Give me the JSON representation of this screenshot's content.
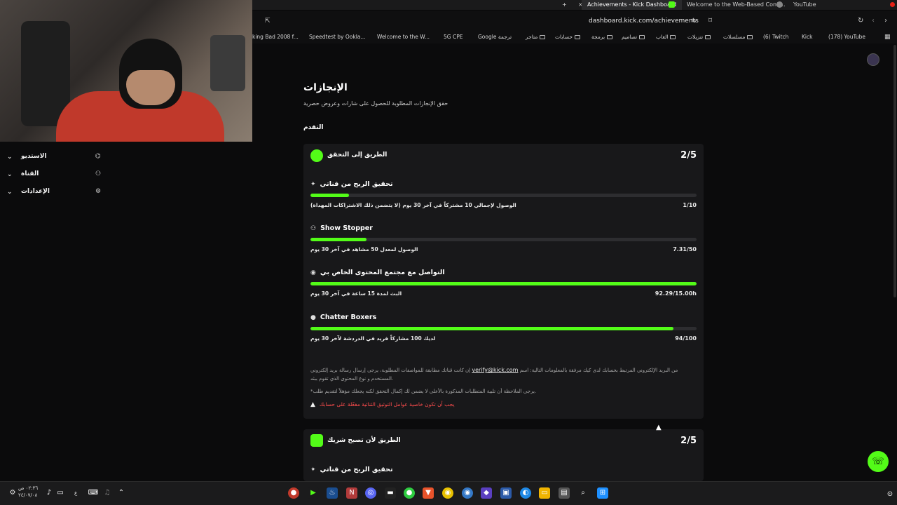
{
  "browser": {
    "tabs": [
      {
        "label": "Achievements - Kick Dashboard",
        "active": true
      },
      {
        "label": "Welcome to the Web-Based Confi...",
        "active": false
      },
      {
        "label": "YouTube",
        "active": false
      }
    ],
    "new_tab": "+",
    "close_tab": "×",
    "url": "dashboard.kick.com/achievements",
    "bookmarks": [
      "king Bad 2008 f...",
      "Speedtest by Ookla...",
      "Welcome to the W...",
      "5G CPE",
      "Google ترجمة",
      "متاجر",
      "حسابات",
      "برمجة",
      "تصاميم",
      "العاب",
      "تنزيلات",
      "مسلسلات",
      "(6) Twitch",
      "Kick",
      "(178) YouTube"
    ]
  },
  "sidebar": {
    "items": [
      {
        "label": "الاستديو",
        "icon": "studio-icon"
      },
      {
        "label": "القناة",
        "icon": "channel-icon"
      },
      {
        "label": "الإعدادات",
        "icon": "gear-icon"
      }
    ]
  },
  "page": {
    "title": "الإنجازات",
    "subtitle": "حقق الإنجازات المطلوبة للحصول على شارات وعروض حصرية",
    "section": "التقدم"
  },
  "cards": [
    {
      "title": "الطريق إلى التحقق",
      "count": "2/5",
      "icon_color": "#53fc18",
      "achievements": [
        {
          "title": "تحقيق الربح من قناتي",
          "icon": "sparkle-icon",
          "desc": "الوصول لإجمالي 10 مشتركاً في آخر 30 يوم (لا يتضمن ذلك الاشتراكات المهداة)",
          "value": "1/10",
          "progress": 0.1
        },
        {
          "title": "Show Stopper",
          "icon": "users-icon",
          "desc": "الوصول لمعدل 50 مشاهد في آخر 30 يوم",
          "value": "7.31/50",
          "progress": 0.146
        },
        {
          "title": "التواصل مع مجتمع المحتوى الخاص بي",
          "icon": "broadcast-icon",
          "desc": "البث لمدة 15 ساعة في آخر 30 يوم",
          "value": "92.29/15.00h",
          "progress": 1.0
        },
        {
          "title": "Chatter Boxers",
          "icon": "chat-icon",
          "desc": "لديك 100 مشاركاً فريد في الدردشة لآخر 30 يوم",
          "value": "94/100",
          "progress": 0.94
        }
      ],
      "note_1_a": "إن كانت قناتك مطابقة للمواصفات المطلوبة، يرجى إرسال رسالة بريد إلكتروني",
      "note_email": "verify@kick.com",
      "note_1_b": "من البريد الإلكتروني المرتبط بحسابك لدى كيك مرفقة بالمعلومات التالية: اسم المستخدم و نوع المحتوى الذي تقوم ببثه.",
      "note_2": "*يرجى الملاحظة أن تلبية المتطلبات المذكورة بالأعلى لا يضمن لك إكمال التحقق لكنه يجعلك مؤهلاً لتقديم طلب.",
      "warning": "يجب أن تكون خاصية عوامل التوثيق الثنائية مفعّلة على حسابك"
    },
    {
      "title": "الطريق لأن تصبح شريك",
      "count": "2/5",
      "icon_color": "#53fc18",
      "achievements": [
        {
          "title": "تحقيق الربح من قناتي",
          "icon": "sparkle-icon"
        }
      ]
    }
  ],
  "taskbar": {
    "time": "٠٢:٣٦ ص",
    "date": "٢٤/٠٧/٠٨",
    "lang": "ع"
  },
  "colors": {
    "accent": "#53fc18",
    "card": "#18181a",
    "bg": "#0b0b0c",
    "warning": "#ff4d4d"
  }
}
